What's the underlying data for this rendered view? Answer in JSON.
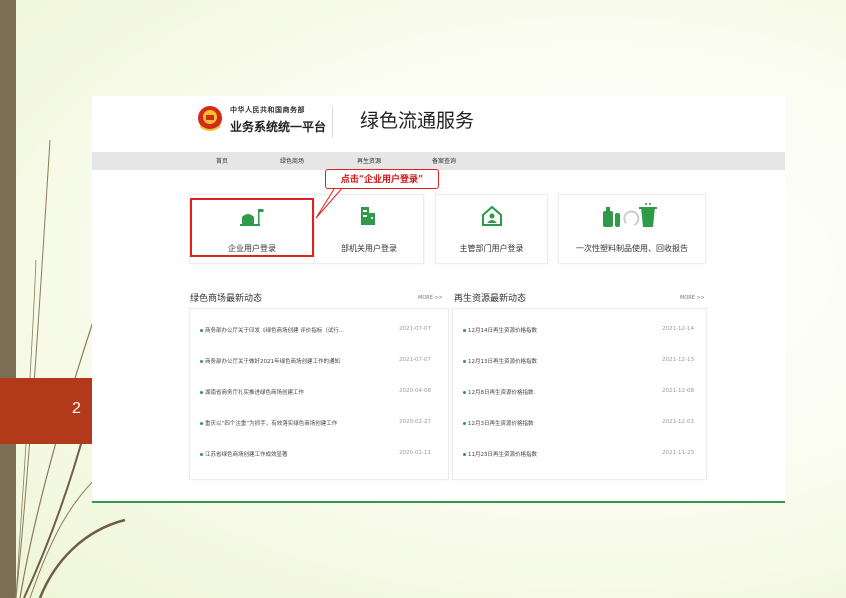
{
  "slide": {
    "number": "2"
  },
  "header": {
    "org_name": "中华人民共和国商务部",
    "system_name": "业务系统统一平台",
    "service_title": "绿色流通服务"
  },
  "nav": {
    "items": [
      "首页",
      "绿色商场",
      "再生资源",
      "备案查询"
    ]
  },
  "callout": {
    "text": "点击“企业用户登录”"
  },
  "cards": [
    {
      "label": "企业用户登录",
      "icon": "enterprise-icon"
    },
    {
      "label": "部机关用户登录",
      "icon": "building-icon"
    },
    {
      "label": "主管部门用户登录",
      "icon": "house-user-icon"
    },
    {
      "label": "一次性塑料制品使用、回收报告",
      "icon": "recycle-bin-icon"
    }
  ],
  "green_mall": {
    "title": "绿色商场最新动态",
    "more": "MORE >>",
    "items": [
      {
        "text": "商务部办公厅关于印发《绿色商场创建 评价指标（试行...",
        "date": "2021-07-07"
      },
      {
        "text": "商务部办公厅关于做好2021年绿色商场创建工作的通知",
        "date": "2021-07-07"
      },
      {
        "text": "湖南省商务厅扎实推进绿色商场创建工作",
        "date": "2020-04-08"
      },
      {
        "text": "重庆以“四个注重”为抓手，有效落实绿色商场创建工作",
        "date": "2020-02-27"
      },
      {
        "text": "江苏省绿色商场创建工作成效显著",
        "date": "2020-02-11"
      }
    ]
  },
  "recycling": {
    "title": "再生资源最新动态",
    "more": "MORE >>",
    "items": [
      {
        "text": "12月14日再生资源价格指数",
        "date": "2021-12-14"
      },
      {
        "text": "12月13日再生资源价格指数",
        "date": "2021-12-13"
      },
      {
        "text": "12月8日再生资源价格指数",
        "date": "2021-12-08"
      },
      {
        "text": "12月3日再生资源价格指数",
        "date": "2021-12-03"
      },
      {
        "text": "11月23日再生资源价格指数",
        "date": "2021-11-23"
      }
    ]
  },
  "colors": {
    "accent_green": "#2f9a4a",
    "highlight_red": "#e02020",
    "slide_bar": "#7d6f55",
    "slide_num_bg": "#b23a1b"
  }
}
